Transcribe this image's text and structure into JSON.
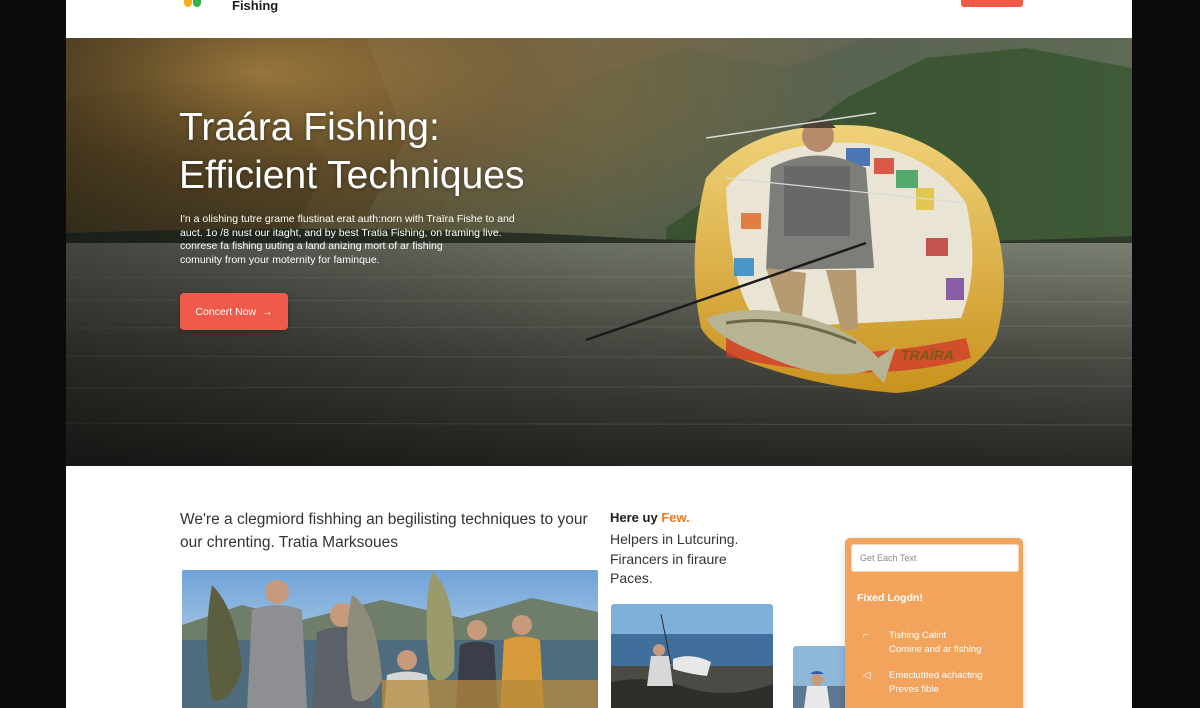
{
  "header": {
    "brand": "Fishing"
  },
  "hero": {
    "title_lines": [
      "Traára Fishing:",
      "Efficient Techniques"
    ],
    "description_lines": [
      "I'n a olishing tutre grame flustinat erat auth:norn with Traïra Fishe to and",
      "auct. 1o /8 nust our itaght, and by best Tratia Fishing, on traming live.",
      "conrese fa fishing uuting a land anizing mort of ar fishing",
      "comunity from your moternity for faminque."
    ],
    "button_label": "Concert Now",
    "button_arrow": "→",
    "boat_name": "TRAÏRA"
  },
  "intro": {
    "lines": [
      "We're a clegmiord fishhing an begilisting techniques to your",
      "our chrenting. Tratia Marksoues"
    ]
  },
  "middle": {
    "heading_prefix": "Here uy ",
    "heading_accent": "Few.",
    "lines": [
      "Helpers in Lutcuring.",
      "Firancers in firaure",
      "Paces."
    ]
  },
  "card": {
    "input_placeholder": "Get Each Text",
    "title": "Fixed Logdn!",
    "items": [
      {
        "icon": "fishing-rod-icon",
        "lines": [
          "Tishing Calint",
          "Comine and ar fishing"
        ]
      },
      {
        "icon": "fish-icon",
        "lines": [
          "Emecluttted achacting",
          "Preves fible"
        ]
      }
    ]
  },
  "colors": {
    "accent_red": "#ee5b4b",
    "accent_orange": "#f07a1c",
    "card_orange": "#f2a45c"
  }
}
